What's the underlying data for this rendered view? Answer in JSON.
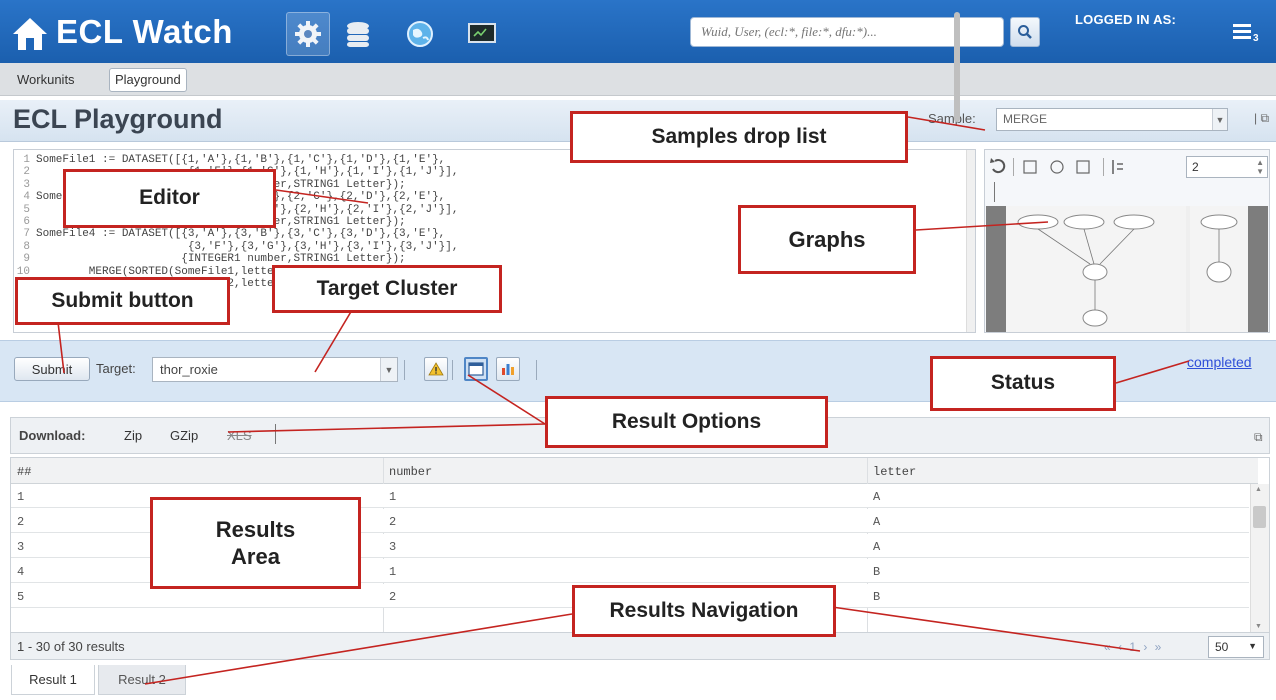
{
  "header": {
    "app_title": "ECL Watch",
    "search_placeholder": "Wuid, User, (ecl:*, file:*, dfu:*)...",
    "logged_in_label": "LOGGED IN AS:",
    "menu_badge": "3",
    "icons": [
      "home-icon",
      "gear-icon",
      "database-icon",
      "globe-icon",
      "monitor-icon",
      "search-icon",
      "menu-icon"
    ],
    "brand_color": "#1f66b8"
  },
  "breadcrumb": [
    "Workunits",
    "Playground"
  ],
  "page": {
    "title": "ECL Playground",
    "sample_label": "Sample:",
    "sample_value": "MERGE"
  },
  "editor": {
    "lines": [
      {
        "n": "1",
        "text": "SomeFile1 := DATASET([{1,'A'},{1,'B'},{1,'C'},{1,'D'},{1,'E'},"
      },
      {
        "n": "2",
        "text": "                       {1,'F'},{1,'G'},{1,'H'},{1,'I'},{1,'J'}],"
      },
      {
        "n": "3",
        "text": "                      {INTEGER1 number,STRING1 Letter});"
      },
      {
        "n": "4",
        "text": "SomeFile2 := DATASET([{2,'A'},{2,'B'},{2,'C'},{2,'D'},{2,'E'},"
      },
      {
        "n": "5",
        "text": "                       {2,'F'},{2,'G'},{2,'H'},{2,'I'},{2,'J'}],"
      },
      {
        "n": "6",
        "text": "                      {INTEGER1 number,STRING1 Letter});"
      },
      {
        "n": "7",
        "text": "SomeFile4 := DATASET([{3,'A'},{3,'B'},{3,'C'},{3,'D'},{3,'E'},"
      },
      {
        "n": "8",
        "text": "                       {3,'F'},{3,'G'},{3,'H'},{3,'I'},{3,'J'}],"
      },
      {
        "n": "9",
        "text": "                      {INTEGER1 number,STRING1 Letter});"
      },
      {
        "n": "10",
        "text": "        MERGE(SORTED(SomeFile1,letter,number),"
      },
      {
        "n": "11",
        "text": "              SORTED(SomeFile2,letter,number),"
      }
    ]
  },
  "graph": {
    "zoom_value": "2"
  },
  "submit_bar": {
    "submit_label": "Submit",
    "target_label": "Target:",
    "target_value": "thor_roxie",
    "status": "completed"
  },
  "download": {
    "label": "Download:",
    "zip": "Zip",
    "gzip": "GZip",
    "xls": "XLS"
  },
  "results": {
    "columns": [
      "##",
      "number",
      "letter"
    ],
    "rows": [
      [
        "1",
        "1",
        "A"
      ],
      [
        "2",
        "2",
        "A"
      ],
      [
        "3",
        "3",
        "A"
      ],
      [
        "4",
        "1",
        "B"
      ],
      [
        "5",
        "2",
        "B"
      ]
    ],
    "footer": "1 - 30 of 30 results",
    "pager": "« ‹ 1 › »",
    "page_size": "50"
  },
  "tabs": [
    "Result 1",
    "Result 2"
  ],
  "callouts": {
    "samples": "Samples drop list",
    "editor": "Editor",
    "graphs": "Graphs",
    "submit": "Submit button",
    "target": "Target Cluster",
    "status": "Status",
    "result_options": "Result Options",
    "results_area": "Results Area",
    "results_navigation": "Results Navigation"
  },
  "colors": {
    "callout_border": "#c42420",
    "status_link": "#2f4fd8"
  }
}
